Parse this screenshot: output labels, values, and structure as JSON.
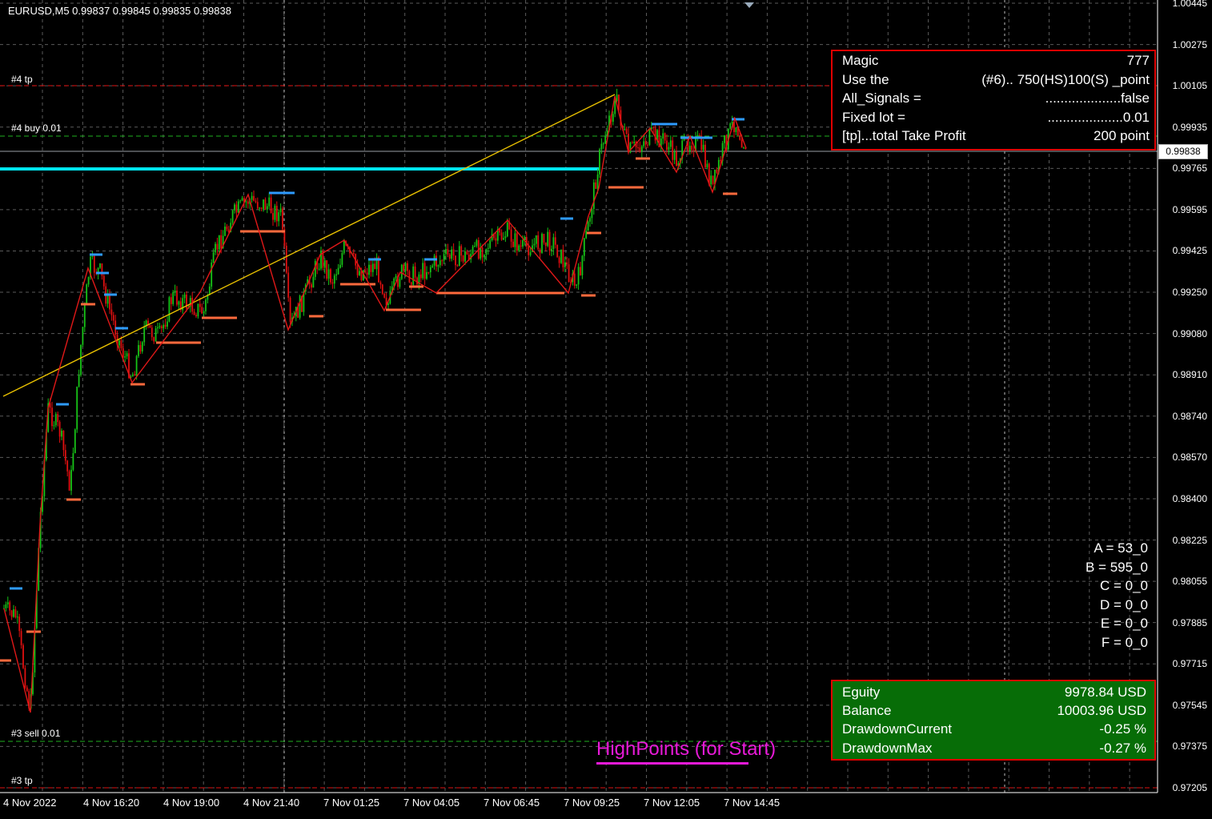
{
  "chart_title": "EURUSD,M5  0.99837 0.99845 0.99835 0.99838",
  "current_price": "0.99838",
  "y_axis_ticks": [
    "1.00445",
    "1.00275",
    "1.00105",
    "0.99935",
    "0.99765",
    "0.99595",
    "0.99425",
    "0.99250",
    "0.99080",
    "0.98910",
    "0.98740",
    "0.98570",
    "0.98400",
    "0.98225",
    "0.98055",
    "0.97885",
    "0.97715",
    "0.97545",
    "0.97375",
    "0.97205"
  ],
  "x_axis_ticks": [
    "4 Nov 2022",
    "4 Nov 16:20",
    "4 Nov 19:00",
    "4 Nov 21:40",
    "7 Nov 01:25",
    "7 Nov 04:05",
    "7 Nov 06:45",
    "7 Nov 09:25",
    "7 Nov 12:05",
    "7 Nov 14:45"
  ],
  "order_labels": {
    "tp4": "#4 tp",
    "buy4": "#4 buy 0.01",
    "sell3": "#3 sell 0.01",
    "tp3": "#3 tp"
  },
  "settings_panel": [
    {
      "key": "Magic",
      "value": "777"
    },
    {
      "key": "Use the",
      "value": "(#6).. 750(HS)100(S) _point"
    },
    {
      "key": "All_Signals =",
      "value": "....................false"
    },
    {
      "key": "Fixed lot =",
      "value": "....................0.01"
    },
    {
      "key": "[tp]...total Take Profit",
      "value": "200 point"
    }
  ],
  "counters": [
    "A = 53_0",
    "B = 595_0",
    "C = 0_0",
    "D = 0_0",
    "E = 0_0",
    "F = 0_0"
  ],
  "account_panel": [
    {
      "key": "Eguity",
      "value": "9978.84 USD"
    },
    {
      "key": "Balance",
      "value": "10003.96 USD"
    },
    {
      "key": "DrawdownCurrent",
      "value": "-0.25 %"
    },
    {
      "key": "DrawdownMax",
      "value": "-0.27 %"
    }
  ],
  "highpoints_label": "HighPoints (for Start)",
  "colors": {
    "background": "#000000",
    "grid": "#5a5a5a",
    "bull": "#17c417",
    "bear": "#e01010",
    "zigzag": "#e01818",
    "trendline": "#e8c000",
    "cyan_level": "#00e5ee",
    "blue_mark": "#2e9bff",
    "orange_mark": "#ff6a3d",
    "panel_border": "#e00000",
    "account_bg": "#076d07",
    "magenta": "#e81ad8"
  },
  "chart_data": {
    "type": "candlestick",
    "symbol": "EURUSD",
    "timeframe": "M5",
    "ylim": [
      0.97205,
      1.00445
    ],
    "level_lines": [
      {
        "label": "#4 tp",
        "price": 1.00105
      },
      {
        "label": "#4 buy 0.01",
        "price": 0.999
      },
      {
        "label": "#3 sell 0.01",
        "price": 0.9739
      },
      {
        "label": "#3 tp",
        "price": 0.97205
      }
    ],
    "zigzag": [
      0.9781,
      0.9752,
      0.9833,
      0.9937,
      0.989,
      0.99155,
      0.9964,
      0.9903,
      0.9944,
      0.9927,
      0.9941,
      0.9917,
      0.9934,
      0.9925,
      0.9953,
      0.9925,
      0.9959,
      0.9999,
      0.9981,
      0.9996,
      0.9976,
      0.9996,
      0.9988
    ]
  }
}
